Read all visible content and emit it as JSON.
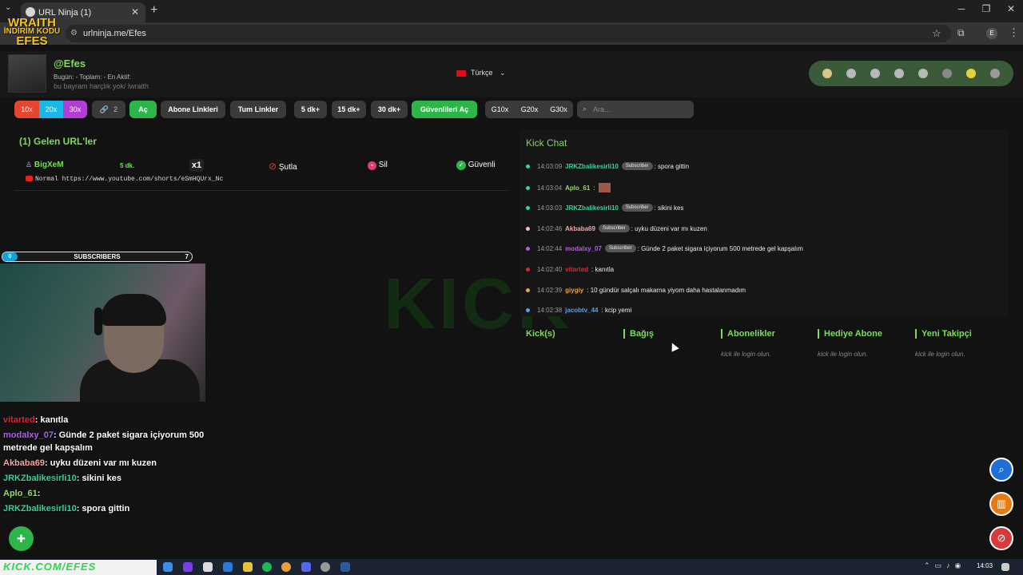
{
  "browser": {
    "tab_title": "URL Ninja (1)",
    "url": "urlninja.me/Efes",
    "profile_initial": "E"
  },
  "logo": {
    "line1": "WRAITH",
    "line2": "İNDİRİM KODU",
    "line3": "EFES"
  },
  "header": {
    "username": "@Efes",
    "stats": "Bugün:  -   Toplam:  -   En Aktif:",
    "bio": "bu bayram harçlık yok/ lwraith",
    "language": "Türkçe"
  },
  "toolbar": {
    "b10x": "10x",
    "b20x": "20x",
    "b30x": "30x",
    "link_count": "2",
    "open": "Aç",
    "sub_links": "Abone Linkleri",
    "all_links": "Tum Linkler",
    "min5": "5 dk+",
    "min15": "15 dk+",
    "min30": "30 dk+",
    "open_safe": "Güvenlileri Aç",
    "g10": "G10x",
    "g20": "G20x",
    "g30": "G30x",
    "search_placeholder": "Ara..."
  },
  "incoming": {
    "title": "(1) Gelen URL'ler",
    "rows": [
      {
        "user": "BigXeM",
        "age": "5 dk.",
        "multiplier": "x1",
        "kick_label": "Şutla",
        "delete_label": "Sil",
        "safe_label": "Güvenli",
        "type": "Normal",
        "link": "https://www.youtube.com/shorts/eSmHQUrx_Nc"
      }
    ]
  },
  "kick_chat": {
    "title": "Kick Chat",
    "messages": [
      {
        "time": "14:03:09",
        "user": "JRKZbalikesirli10",
        "badge": "Subscriber",
        "msg": ": spora gittin",
        "color": "#3fd0a0",
        "dot": "#3fd0a0"
      },
      {
        "time": "14:03:04",
        "user": "Aplo_61",
        "badge": "",
        "msg": ":",
        "color": "#9bd86a",
        "dot": "#3fd0a0",
        "emote": true
      },
      {
        "time": "14:03:03",
        "user": "JRKZbalikesirli10",
        "badge": "Subscriber",
        "msg": ": sikini kes",
        "color": "#3fd0a0",
        "dot": "#3fd0a0"
      },
      {
        "time": "14:02:46",
        "user": "Akbaba69",
        "badge": "Subscriber",
        "msg": ": uyku düzeni var mı kuzen",
        "color": "#f0a8a8",
        "dot": "#f0c0c0"
      },
      {
        "time": "14:02:44",
        "user": "modalxy_07",
        "badge": "Subscriber",
        "msg": ": Günde 2 paket sigara içiyorum 500 metrede gel kapşalım",
        "color": "#b45ee8",
        "dot": "#b45ee8"
      },
      {
        "time": "14:02:40",
        "user": "vitarted",
        "badge": "",
        "msg": ": kanıtla",
        "color": "#d42a3a",
        "dot": "#d42a3a"
      },
      {
        "time": "14:02:39",
        "user": "giygiy",
        "badge": "",
        "msg": ": 10 gündür salçalı makarna yiyom daha hastalanmadım",
        "color": "#e8a63a",
        "dot": "#e8a63a"
      },
      {
        "time": "14:02:38",
        "user": "jacobtv_44",
        "badge": "",
        "msg": ": kcip yemi",
        "color": "#5aa0e0",
        "dot": "#5aa0e0"
      }
    ]
  },
  "kick_sections": {
    "kicks": "Kick(s)",
    "donation": "Bağış",
    "subscribers": "Abonelikler",
    "gift_sub": "Hediye Abone",
    "new_follower": "Yeni Takipçi",
    "login_hint": "kick ile login olun."
  },
  "overlay": {
    "sub_label": "SUBSCRIBERS",
    "sub_start": "0",
    "sub_goal": "7",
    "chat": [
      {
        "user": "vitarted",
        "msg": ": kanıtla",
        "color": "#d42a3a"
      },
      {
        "user": "modalxy_07",
        "msg": ": Günde 2 paket sigara içiyorum 500",
        "color": "#b45ee8"
      },
      {
        "user": "",
        "msg": "metrede gel kapşalım",
        "color": "#ffffff"
      },
      {
        "user": "Akbaba69",
        "msg": ": uyku düzeni var mı kuzen",
        "color": "#f0a8a8"
      },
      {
        "user": "JRKZbalikesirli10",
        "msg": ": sikini kes",
        "color": "#3fd0a0"
      },
      {
        "user": "Aplo_61",
        "msg": ":",
        "color": "#9bd86a"
      },
      {
        "user": "JRKZbalikesirli10",
        "msg": ": spora gittin",
        "color": "#3fd0a0"
      }
    ]
  },
  "taskbar": {
    "watermark": "KICK.COM/EFES",
    "time": "14:03"
  },
  "colors": {
    "accent_green": "#7ddc5a",
    "kick_green": "#2cb64a",
    "btn_red": "#e5462f",
    "btn_cyan": "#19b8e6",
    "btn_purple": "#b23ed6",
    "btn_dark": "#3a3a3a"
  },
  "icons": {
    "fab_search": "search-icon",
    "fab_gift": "gift-icon",
    "fab_block": "user-block-icon",
    "fab_add": "user-add-icon"
  }
}
